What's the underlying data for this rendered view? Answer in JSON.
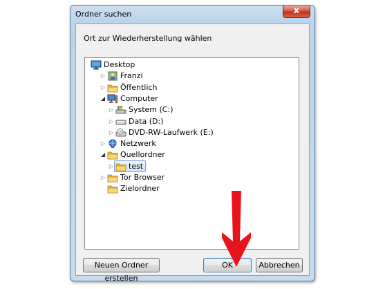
{
  "dialog": {
    "title": "Ordner suchen",
    "close_label": "x",
    "instruction": "Ort zur Wiederherstellung wählen"
  },
  "tree": {
    "items": [
      {
        "label": "Desktop",
        "icon": "desktop-icon",
        "level": 0,
        "expander": "none"
      },
      {
        "label": "Franzi",
        "icon": "user-folder-icon",
        "level": 1,
        "expander": "collapsed"
      },
      {
        "label": "Öffentlich",
        "icon": "folder-icon",
        "level": 1,
        "expander": "collapsed"
      },
      {
        "label": "Computer",
        "icon": "computer-icon",
        "level": 1,
        "expander": "expanded"
      },
      {
        "label": "System (C:)",
        "icon": "system-drive-icon",
        "level": 2,
        "expander": "collapsed"
      },
      {
        "label": "Data (D:)",
        "icon": "hard-drive-icon",
        "level": 2,
        "expander": "collapsed"
      },
      {
        "label": "DVD-RW-Laufwerk (E:)",
        "icon": "dvd-drive-icon",
        "level": 2,
        "expander": "collapsed"
      },
      {
        "label": "Netzwerk",
        "icon": "network-icon",
        "level": 1,
        "expander": "collapsed"
      },
      {
        "label": "Quellordner",
        "icon": "folder-icon",
        "level": 1,
        "expander": "expanded"
      },
      {
        "label": "test",
        "icon": "folder-icon",
        "level": 2,
        "expander": "collapsed",
        "selected": true
      },
      {
        "label": "Tor Browser",
        "icon": "folder-icon",
        "level": 1,
        "expander": "collapsed"
      },
      {
        "label": "Zielordner",
        "icon": "folder-icon",
        "level": 1,
        "expander": "none"
      }
    ]
  },
  "buttons": {
    "new_folder": "Neuen Ordner erstellen",
    "ok": "OK",
    "cancel": "Abbrechen"
  },
  "annotation": {
    "color": "#e8141b",
    "points_to": "OK"
  }
}
